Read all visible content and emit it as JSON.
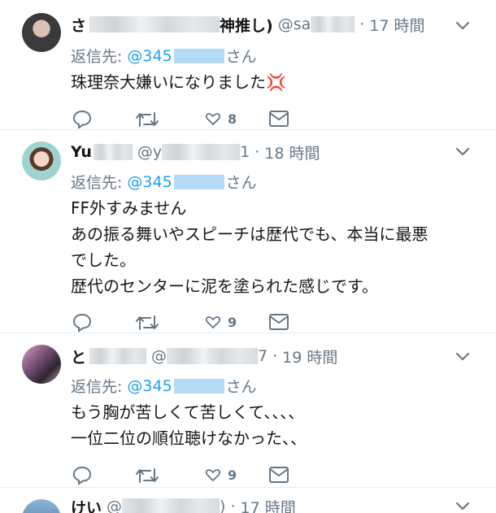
{
  "tweets": [
    {
      "name": "さ",
      "name_suffix": "神推し)",
      "handle": "@sa",
      "sep": "·",
      "time": "17 時間",
      "reply_prefix": "返信先:",
      "reply_mention": "@345",
      "reply_suffix": "さん",
      "lines": [
        "珠理奈大嫌いになりました💢"
      ],
      "like_count": "8",
      "avatar_color": "#5a5a5a"
    },
    {
      "name": "Yu",
      "name_suffix": "",
      "handle": "@y",
      "handle_tail": "1",
      "sep": "·",
      "time": "18 時間",
      "reply_prefix": "返信先:",
      "reply_mention": "@345",
      "reply_suffix": "さん",
      "lines": [
        "FF外すみません",
        "あの振る舞いやスピーチは歴代でも、本当に最悪",
        "でした。",
        "歴代のセンターに泥を塗られた感じです。"
      ],
      "like_count": "9",
      "avatar_color": "#7fc7c4"
    },
    {
      "name": "と",
      "name_suffix": "",
      "handle": "@",
      "handle_tail": "7",
      "sep": "·",
      "time": "19 時間",
      "reply_prefix": "返信先:",
      "reply_mention": "@345",
      "reply_suffix": "さん",
      "lines": [
        "もう胸が苦しくて苦しくて、、、、",
        "一位二位の順位聴けなかった、、"
      ],
      "like_count": "9",
      "avatar_color": "#8b6c8e"
    },
    {
      "name": "けい",
      "handle": "@",
      "handle_tail": ")",
      "sep": "·",
      "time": "17 時間",
      "avatar_color": "#4a7fb0"
    }
  ],
  "colors": {
    "accent": "#1da1f2",
    "muted": "#657786",
    "text": "#14171a"
  },
  "icons": [
    "reply-icon",
    "retweet-icon",
    "like-icon",
    "dm-icon",
    "chevron-down-icon"
  ]
}
